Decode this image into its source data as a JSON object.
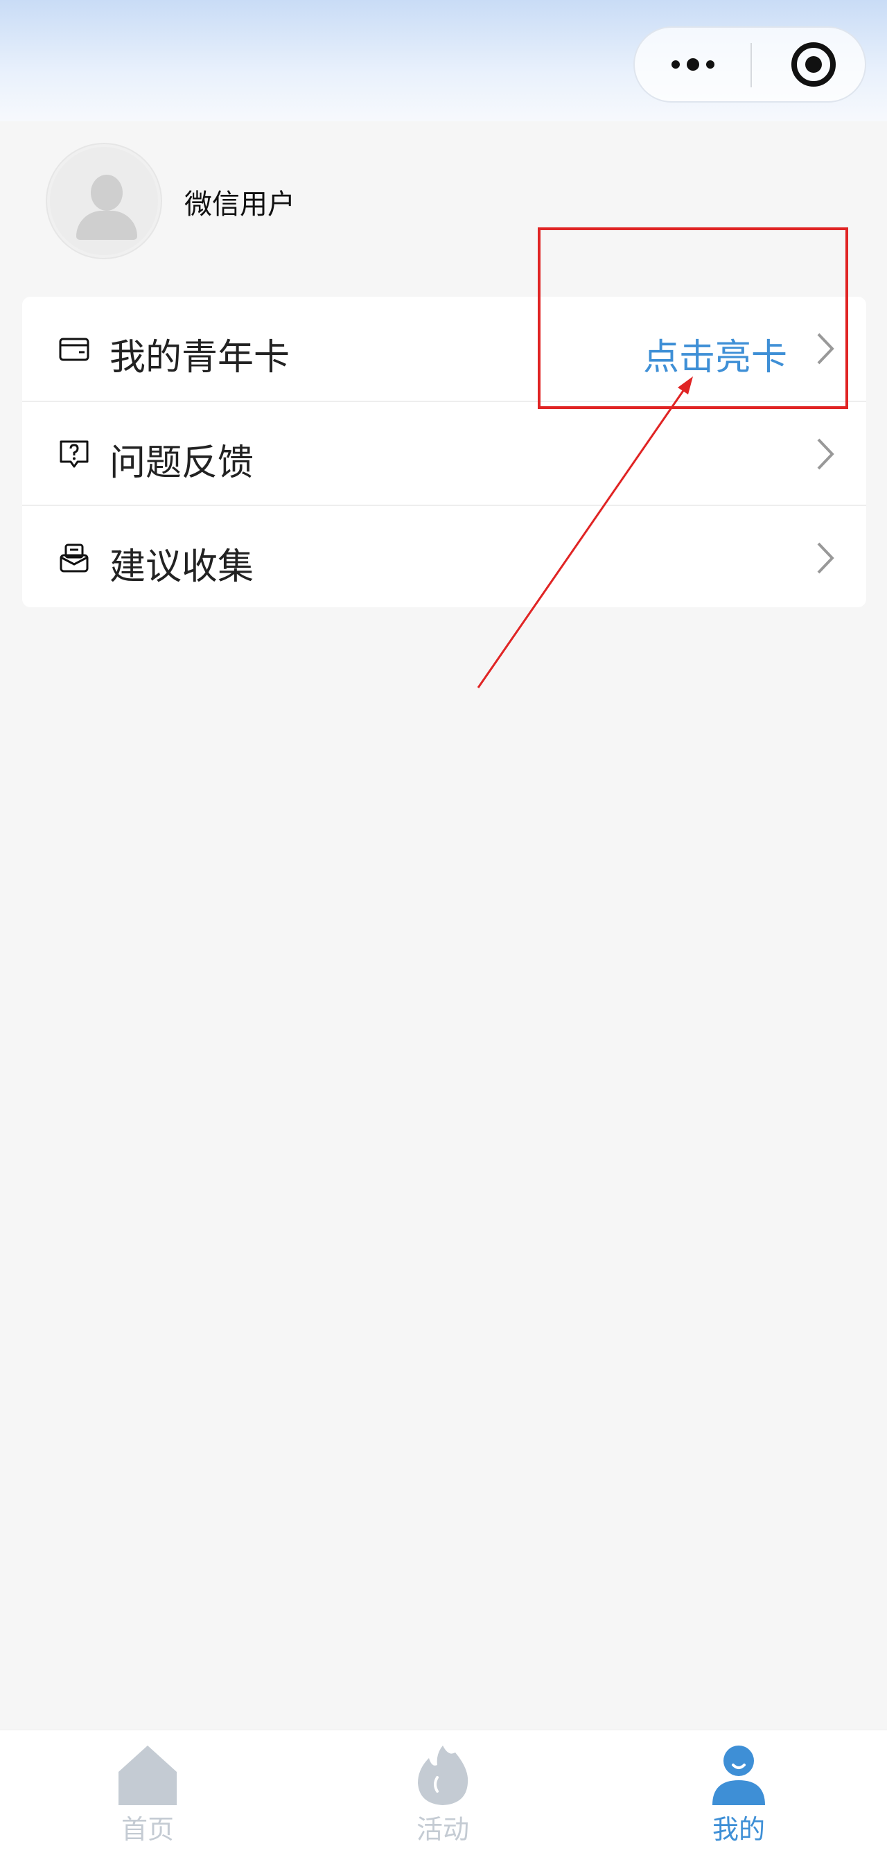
{
  "profile": {
    "username": "微信用户"
  },
  "menu": {
    "items": [
      {
        "label": "我的青年卡",
        "action": "点击亮卡",
        "icon": "wallet-card-icon"
      },
      {
        "label": "问题反馈",
        "action": "",
        "icon": "feedback-question-icon"
      },
      {
        "label": "建议收集",
        "action": "",
        "icon": "suggestion-box-icon"
      }
    ]
  },
  "capsule": {
    "icons": [
      "more-dots-icon",
      "close-target-icon"
    ]
  },
  "tabbar": {
    "tabs": [
      {
        "label": "首页",
        "icon": "home-icon",
        "active": false
      },
      {
        "label": "活动",
        "icon": "flame-icon",
        "active": false
      },
      {
        "label": "我的",
        "icon": "user-icon",
        "active": true
      }
    ],
    "active_color": "#3e8fd6",
    "inactive_color": "#c4cbd3"
  },
  "annotation": {
    "color": "#e02424"
  },
  "colors": {
    "accent": "#3e8fd6",
    "background": "#f6f6f6"
  }
}
